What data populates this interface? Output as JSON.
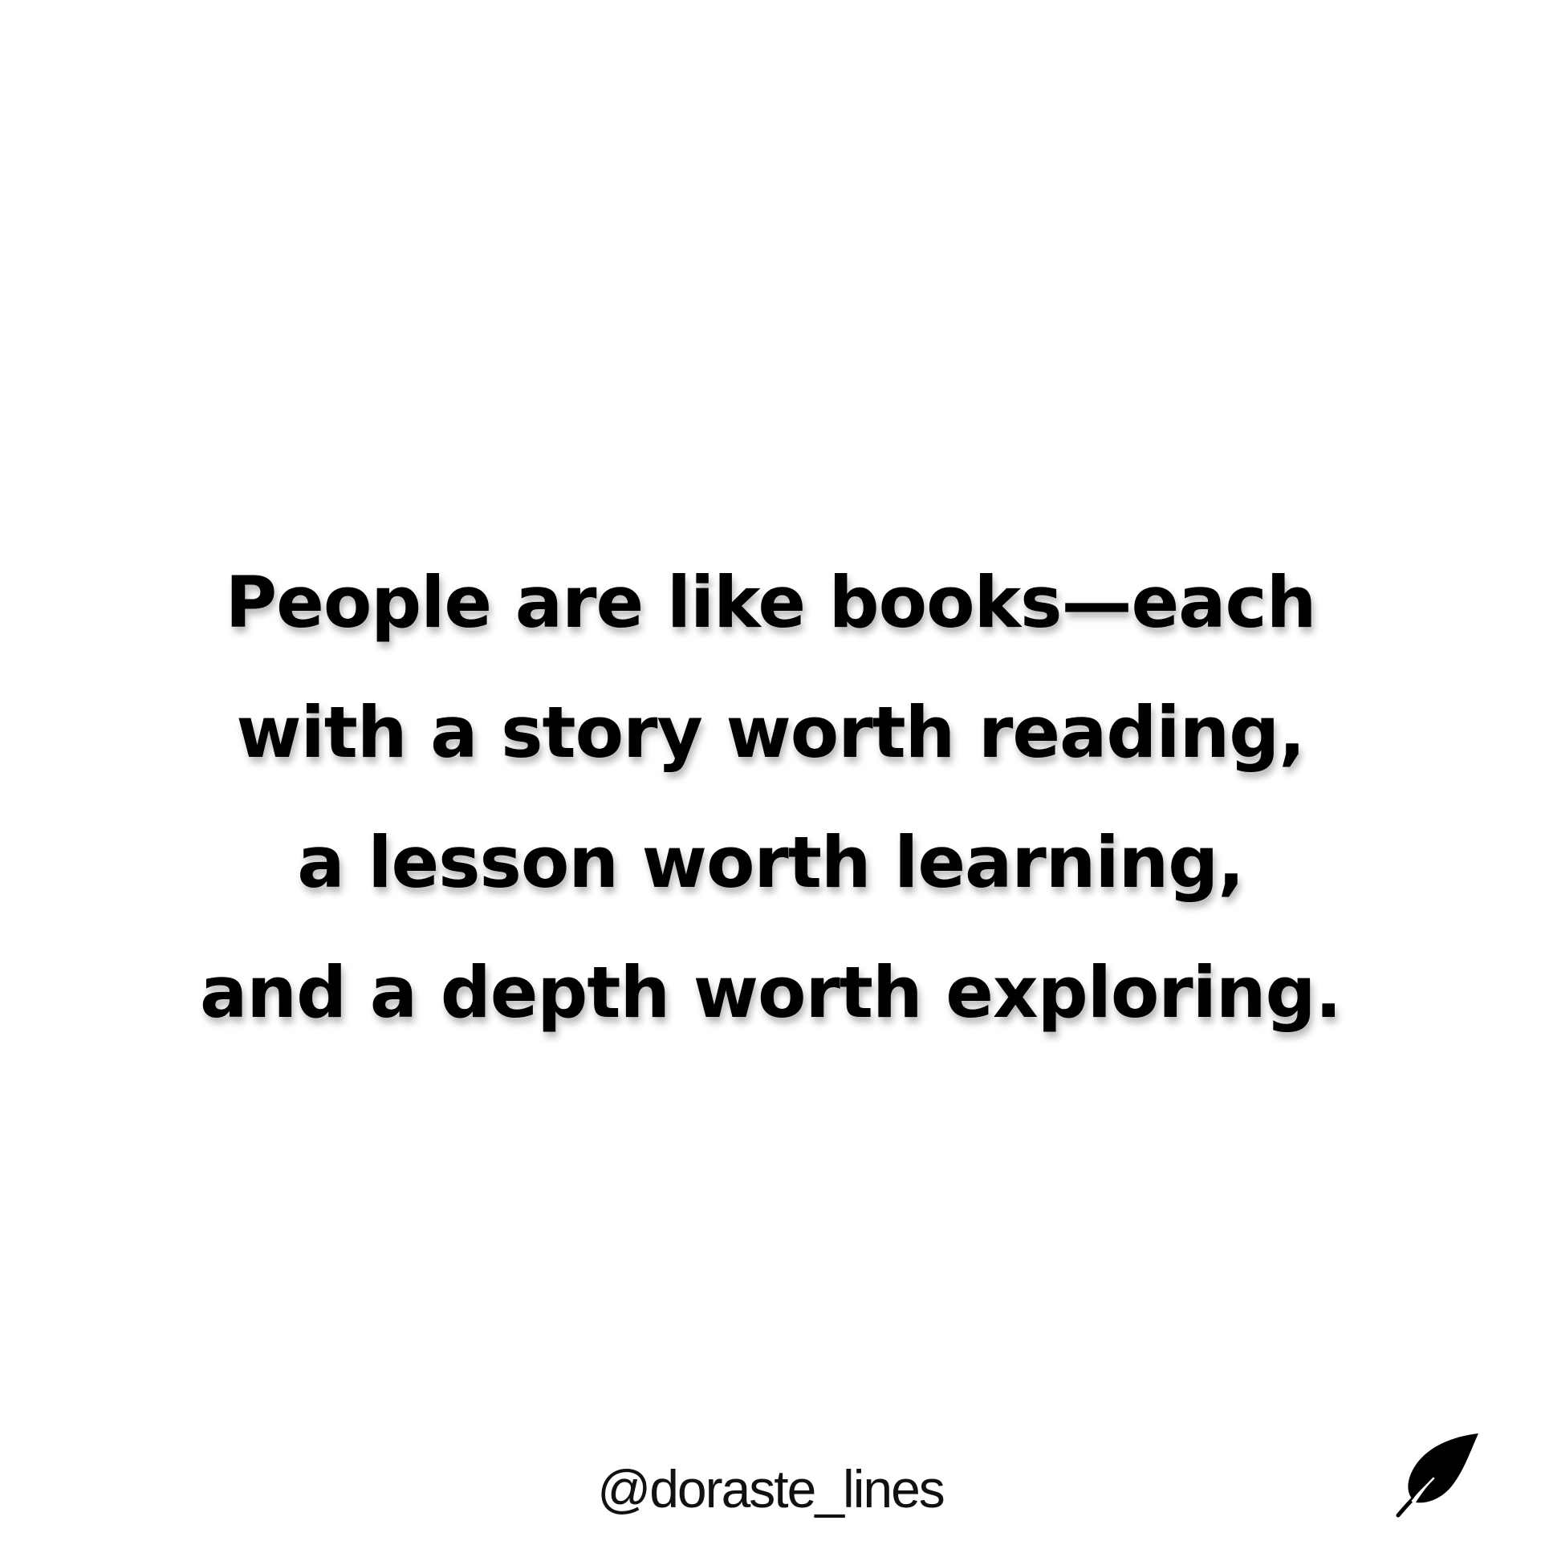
{
  "quote": {
    "lines": [
      "People are like books—each",
      "with a story worth reading,",
      "a lesson worth learning,",
      "and a depth worth exploring."
    ]
  },
  "footer": {
    "handle": "@doraste_lines",
    "icon": "leaf-icon"
  },
  "colors": {
    "background": "#ffffff",
    "text": "#000000"
  }
}
